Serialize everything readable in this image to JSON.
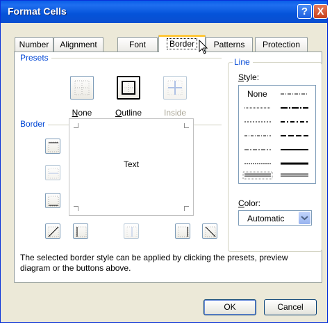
{
  "window": {
    "title": "Format Cells",
    "help_label": "?",
    "close_label": "X"
  },
  "tabs": [
    {
      "label": "Number"
    },
    {
      "label": "Alignment"
    },
    {
      "label": "Font"
    },
    {
      "label": "Border"
    },
    {
      "label": "Patterns"
    },
    {
      "label": "Protection"
    }
  ],
  "presets": {
    "title": "Presets",
    "items": [
      {
        "label": "None",
        "mnemonic": "N",
        "rest": "one"
      },
      {
        "label": "Outline",
        "mnemonic": "O",
        "rest": "utline"
      },
      {
        "label": "Inside"
      }
    ]
  },
  "border": {
    "title": "Border",
    "preview_text": "Text"
  },
  "line": {
    "title": "Line",
    "style_label_mnemonic": "S",
    "style_label_rest": "tyle:",
    "none_label": "None",
    "color_label_mnemonic": "C",
    "color_label_rest": "olor:",
    "color_value": "Automatic"
  },
  "info_text": "The selected border style can be applied by clicking the presets, preview diagram or the buttons above.",
  "buttons": {
    "ok": "OK",
    "cancel": "Cancel"
  },
  "colors": {
    "title_bar": "#0553d9",
    "group_label": "#0046d5",
    "active_tab_accent": "#ffc83c"
  }
}
